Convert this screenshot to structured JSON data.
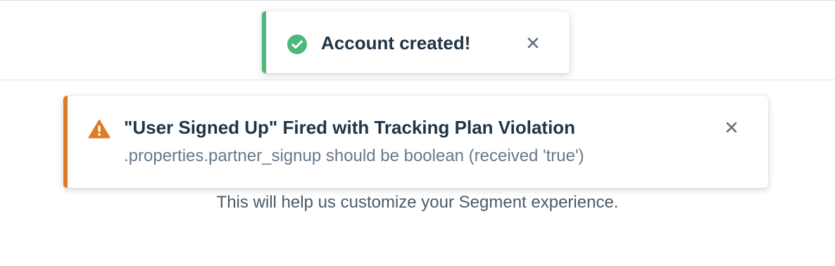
{
  "page": {
    "subtitle": "This will help us customize your Segment experience."
  },
  "toasts": {
    "success": {
      "message": "Account created!",
      "icon": "check-circle-icon",
      "accent_color": "#4cb97b",
      "close_icon": "close-icon"
    },
    "warning": {
      "title": "\"User Signed Up\" Fired with Tracking Plan Violation",
      "detail": ".properties.partner_signup should be boolean (received 'true')",
      "icon": "warning-triangle-icon",
      "accent_color": "#e07b24",
      "close_icon": "close-icon"
    }
  }
}
